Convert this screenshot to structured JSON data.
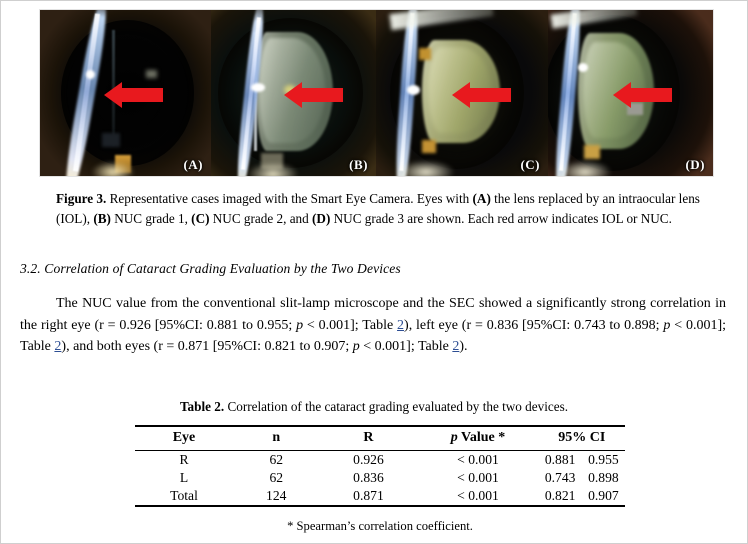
{
  "figure": {
    "panels": [
      {
        "id": "a",
        "label": "(A)",
        "alt": "slit-lamp photo of eye with intraocular lens",
        "arrow": "red-arrow-left"
      },
      {
        "id": "b",
        "label": "(B)",
        "alt": "slit-lamp photo of eye with NUC grade 1 cataract",
        "arrow": "red-arrow-left"
      },
      {
        "id": "c",
        "label": "(C)",
        "alt": "slit-lamp photo of eye with NUC grade 2 cataract",
        "arrow": "red-arrow-left"
      },
      {
        "id": "d",
        "label": "(D)",
        "alt": "slit-lamp photo of eye with NUC grade 3 cataract",
        "arrow": "red-arrow-left"
      }
    ],
    "caption_label": "Figure 3.",
    "caption_text_1": " Representative cases imaged with the Smart Eye Camera. Eyes with ",
    "caption_b_a": "(A)",
    "caption_text_2": " the lens replaced by an intraocular lens (IOL), ",
    "caption_b_b": "(B)",
    "caption_text_3": " NUC grade 1, ",
    "caption_b_c": "(C)",
    "caption_text_4": " NUC grade 2, and ",
    "caption_b_d": "(D)",
    "caption_text_5": " NUC grade 3 are shown. Each red arrow indicates IOL or NUC."
  },
  "section": {
    "heading": "3.2. Correlation of Cataract Grading Evaluation by the Two Devices"
  },
  "paragraph": {
    "seg1": "The NUC value from the conventional slit-lamp microscope and the SEC showed a significantly strong correlation in the right eye (r = 0.926 [95%CI: 0.881 to 0.955; ",
    "ital1": "p",
    "seg2": " < 0.001]; Table ",
    "link1": "2",
    "seg3": "), left eye (r = 0.836 [95%CI: 0.743 to 0.898; ",
    "ital2": "p",
    "seg4": " < 0.001]; Table ",
    "link2": "2",
    "seg5": "), and both eyes (r = 0.871 [95%CI: 0.821 to 0.907; ",
    "ital3": "p",
    "seg6": " < 0.001]; Table ",
    "link3": "2",
    "seg7": ")."
  },
  "table": {
    "caption_label": "Table 2.",
    "caption_text": " Correlation of the cataract grading evaluated by the two devices.",
    "headers": [
      "Eye",
      "n",
      "R",
      "p Value *",
      "95% CI"
    ],
    "header_p_italic": "p",
    "header_p_rest": " Value *",
    "rows": [
      {
        "eye": "R",
        "n": "62",
        "r": "0.926",
        "p": "< 0.001",
        "ci_low": "0.881",
        "ci_high": "0.955"
      },
      {
        "eye": "L",
        "n": "62",
        "r": "0.836",
        "p": "< 0.001",
        "ci_low": "0.743",
        "ci_high": "0.898"
      },
      {
        "eye": "Total",
        "n": "124",
        "r": "0.871",
        "p": "< 0.001",
        "ci_low": "0.821",
        "ci_high": "0.907"
      }
    ],
    "footnote": "* Spearman’s correlation coefficient."
  },
  "colors": {
    "arrow_red": "#e8191e",
    "link_blue": "#2d4e93",
    "page_background": "#ffffff",
    "text": "#000000"
  }
}
